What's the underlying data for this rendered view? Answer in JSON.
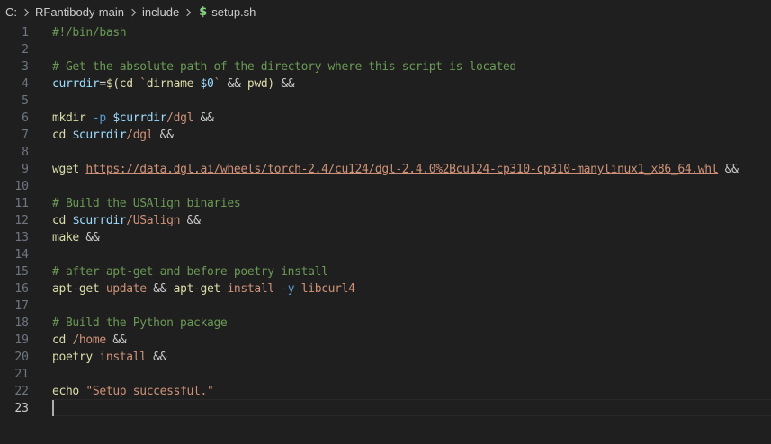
{
  "breadcrumb": {
    "drive": "C:",
    "folder": "RFantibody-main",
    "subfolder": "include",
    "file_icon": "$",
    "file": "setup.sh"
  },
  "editor": {
    "language": "shell",
    "active_line": 23,
    "lines": [
      {
        "num": "1",
        "tokens": [
          {
            "t": "comment",
            "v": "#!/bin/bash"
          }
        ]
      },
      {
        "num": "2",
        "tokens": []
      },
      {
        "num": "3",
        "tokens": [
          {
            "t": "comment",
            "v": "# Get the absolute path of the directory where this script is located"
          }
        ]
      },
      {
        "num": "4",
        "tokens": [
          {
            "t": "var",
            "v": "currdir"
          },
          {
            "t": "plain",
            "v": "="
          },
          {
            "t": "cmd",
            "v": "$("
          },
          {
            "t": "cmd",
            "v": "cd "
          },
          {
            "t": "str",
            "v": "`"
          },
          {
            "t": "cmd",
            "v": "dirname "
          },
          {
            "t": "var",
            "v": "$0"
          },
          {
            "t": "str",
            "v": "`"
          },
          {
            "t": "plain",
            "v": " && "
          },
          {
            "t": "cmd",
            "v": "pwd"
          },
          {
            "t": "cmd",
            "v": ")"
          },
          {
            "t": "plain",
            "v": " &&"
          }
        ]
      },
      {
        "num": "5",
        "tokens": []
      },
      {
        "num": "6",
        "tokens": [
          {
            "t": "cmd",
            "v": "mkdir"
          },
          {
            "t": "plain",
            "v": " "
          },
          {
            "t": "flag",
            "v": "-p"
          },
          {
            "t": "plain",
            "v": " "
          },
          {
            "t": "var",
            "v": "$currdir"
          },
          {
            "t": "arg",
            "v": "/dgl"
          },
          {
            "t": "plain",
            "v": " &&"
          }
        ]
      },
      {
        "num": "7",
        "tokens": [
          {
            "t": "cmd",
            "v": "cd"
          },
          {
            "t": "plain",
            "v": " "
          },
          {
            "t": "var",
            "v": "$currdir"
          },
          {
            "t": "arg",
            "v": "/dgl"
          },
          {
            "t": "plain",
            "v": " &&"
          }
        ]
      },
      {
        "num": "8",
        "tokens": []
      },
      {
        "num": "9",
        "tokens": [
          {
            "t": "cmd",
            "v": "wget"
          },
          {
            "t": "plain",
            "v": " "
          },
          {
            "t": "url",
            "v": "https://data.dgl.ai/wheels/torch-2.4/cu124/dgl-2.4.0%2Bcu124-cp310-cp310-manylinux1_x86_64.whl"
          },
          {
            "t": "plain",
            "v": " &&"
          }
        ]
      },
      {
        "num": "10",
        "tokens": []
      },
      {
        "num": "11",
        "tokens": [
          {
            "t": "comment",
            "v": "# Build the USAlign binaries"
          }
        ]
      },
      {
        "num": "12",
        "tokens": [
          {
            "t": "cmd",
            "v": "cd"
          },
          {
            "t": "plain",
            "v": " "
          },
          {
            "t": "var",
            "v": "$currdir"
          },
          {
            "t": "arg",
            "v": "/USalign"
          },
          {
            "t": "plain",
            "v": " &&"
          }
        ]
      },
      {
        "num": "13",
        "tokens": [
          {
            "t": "cmd",
            "v": "make"
          },
          {
            "t": "plain",
            "v": " &&"
          }
        ]
      },
      {
        "num": "14",
        "tokens": []
      },
      {
        "num": "15",
        "tokens": [
          {
            "t": "comment",
            "v": "# after apt-get and before poetry install"
          }
        ]
      },
      {
        "num": "16",
        "tokens": [
          {
            "t": "cmd",
            "v": "apt-get"
          },
          {
            "t": "plain",
            "v": " "
          },
          {
            "t": "arg",
            "v": "update"
          },
          {
            "t": "plain",
            "v": " && "
          },
          {
            "t": "cmd",
            "v": "apt-get"
          },
          {
            "t": "plain",
            "v": " "
          },
          {
            "t": "arg",
            "v": "install"
          },
          {
            "t": "plain",
            "v": " "
          },
          {
            "t": "flag",
            "v": "-y"
          },
          {
            "t": "plain",
            "v": " "
          },
          {
            "t": "arg",
            "v": "libcurl4"
          }
        ]
      },
      {
        "num": "17",
        "tokens": []
      },
      {
        "num": "18",
        "tokens": [
          {
            "t": "comment",
            "v": "# Build the Python package"
          }
        ]
      },
      {
        "num": "19",
        "tokens": [
          {
            "t": "cmd",
            "v": "cd"
          },
          {
            "t": "plain",
            "v": " "
          },
          {
            "t": "arg",
            "v": "/home"
          },
          {
            "t": "plain",
            "v": " &&"
          }
        ]
      },
      {
        "num": "20",
        "tokens": [
          {
            "t": "cmd",
            "v": "poetry"
          },
          {
            "t": "plain",
            "v": " "
          },
          {
            "t": "arg",
            "v": "install"
          },
          {
            "t": "plain",
            "v": " &&"
          }
        ]
      },
      {
        "num": "21",
        "tokens": []
      },
      {
        "num": "22",
        "tokens": [
          {
            "t": "cmd",
            "v": "echo"
          },
          {
            "t": "plain",
            "v": " "
          },
          {
            "t": "str",
            "v": "\"Setup successful.\""
          }
        ]
      },
      {
        "num": "23",
        "tokens": []
      }
    ]
  },
  "colors": {
    "background": "#1f1f1f",
    "comment": "#6a9955",
    "command": "#dcdcaa",
    "variable": "#9cdcfe",
    "flag": "#569cd6",
    "string": "#ce9178",
    "line_number": "#6e7681"
  }
}
